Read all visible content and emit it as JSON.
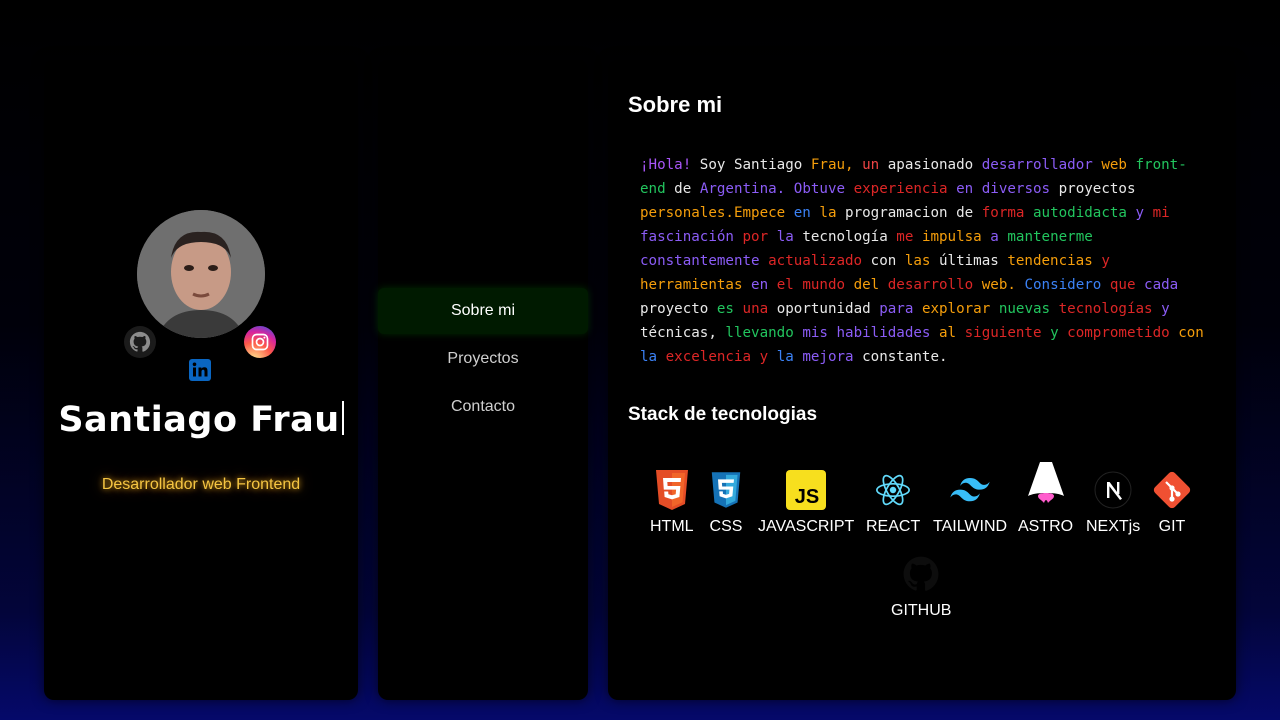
{
  "profile": {
    "name": "Santiago Frau",
    "role": "Desarrollador web Frontend",
    "socials": [
      {
        "icon": "github-icon"
      },
      {
        "icon": "instagram-icon"
      },
      {
        "icon": "linkedin-icon"
      }
    ]
  },
  "nav": {
    "items": [
      {
        "label": "Sobre mi",
        "active": true
      },
      {
        "label": "Proyectos",
        "active": false
      },
      {
        "label": "Contacto",
        "active": false
      }
    ]
  },
  "about": {
    "title": "Sobre mi",
    "words": [
      {
        "t": "¡Hola!",
        "c": "#a855f7"
      },
      {
        "t": "Soy",
        "c": "#e8e8e8"
      },
      {
        "t": "Santiago",
        "c": "#e8e8e8"
      },
      {
        "t": "Frau,",
        "c": "#f59e0b"
      },
      {
        "t": "un",
        "c": "#ef4444"
      },
      {
        "t": "apasionado",
        "c": "#e8e8e8"
      },
      {
        "t": "desarrollador",
        "c": "#8b5cf6"
      },
      {
        "t": "web",
        "c": "#f59e0b"
      },
      {
        "t": "front-end",
        "c": "#22c55e"
      },
      {
        "t": "de",
        "c": "#e8e8e8"
      },
      {
        "t": "Argentina.",
        "c": "#8b5cf6"
      },
      {
        "t": "Obtuve",
        "c": "#8b5cf6"
      },
      {
        "t": "experiencia",
        "c": "#dc2626"
      },
      {
        "t": "en",
        "c": "#8b5cf6"
      },
      {
        "t": "diversos",
        "c": "#8b5cf6"
      },
      {
        "t": "proyectos",
        "c": "#e8e8e8"
      },
      {
        "t": "personales.Empece",
        "c": "#f59e0b"
      },
      {
        "t": "en",
        "c": "#3b82f6"
      },
      {
        "t": "la",
        "c": "#f59e0b"
      },
      {
        "t": "programacion",
        "c": "#e8e8e8"
      },
      {
        "t": "de",
        "c": "#e8e8e8"
      },
      {
        "t": "forma",
        "c": "#dc2626"
      },
      {
        "t": "autodidacta",
        "c": "#22c55e"
      },
      {
        "t": "y",
        "c": "#8b5cf6"
      },
      {
        "t": "mi",
        "c": "#dc2626"
      },
      {
        "t": "fascinación",
        "c": "#8b5cf6"
      },
      {
        "t": "por",
        "c": "#dc2626"
      },
      {
        "t": "la",
        "c": "#8b5cf6"
      },
      {
        "t": "tecnología",
        "c": "#e8e8e8"
      },
      {
        "t": "me",
        "c": "#dc2626"
      },
      {
        "t": "impulsa",
        "c": "#f59e0b"
      },
      {
        "t": "a",
        "c": "#8b5cf6"
      },
      {
        "t": "mantenerme",
        "c": "#22c55e"
      },
      {
        "t": "constantemente",
        "c": "#8b5cf6"
      },
      {
        "t": "actualizado",
        "c": "#dc2626"
      },
      {
        "t": "con",
        "c": "#e8e8e8"
      },
      {
        "t": "las",
        "c": "#f59e0b"
      },
      {
        "t": "últimas",
        "c": "#e8e8e8"
      },
      {
        "t": "tendencias",
        "c": "#f59e0b"
      },
      {
        "t": "y",
        "c": "#dc2626"
      },
      {
        "t": "herramientas",
        "c": "#f59e0b"
      },
      {
        "t": "en",
        "c": "#8b5cf6"
      },
      {
        "t": "el",
        "c": "#dc2626"
      },
      {
        "t": "mundo",
        "c": "#dc2626"
      },
      {
        "t": "del",
        "c": "#f59e0b"
      },
      {
        "t": "desarrollo",
        "c": "#dc2626"
      },
      {
        "t": "web.",
        "c": "#f59e0b"
      },
      {
        "t": "Considero",
        "c": "#3b82f6"
      },
      {
        "t": "que",
        "c": "#dc2626"
      },
      {
        "t": "cada",
        "c": "#8b5cf6"
      },
      {
        "t": "proyecto",
        "c": "#e8e8e8"
      },
      {
        "t": "es",
        "c": "#22c55e"
      },
      {
        "t": "una",
        "c": "#dc2626"
      },
      {
        "t": "oportunidad",
        "c": "#e8e8e8"
      },
      {
        "t": "para",
        "c": "#8b5cf6"
      },
      {
        "t": "explorar",
        "c": "#f59e0b"
      },
      {
        "t": "nuevas",
        "c": "#22c55e"
      },
      {
        "t": "tecnologías",
        "c": "#dc2626"
      },
      {
        "t": "y",
        "c": "#8b5cf6"
      },
      {
        "t": "técnicas,",
        "c": "#e8e8e8"
      },
      {
        "t": "llevando",
        "c": "#22c55e"
      },
      {
        "t": "mis",
        "c": "#8b5cf6"
      },
      {
        "t": "habilidades",
        "c": "#8b5cf6"
      },
      {
        "t": "al",
        "c": "#f59e0b"
      },
      {
        "t": "siguiente",
        "c": "#dc2626"
      },
      {
        "t": "y",
        "c": "#22c55e"
      },
      {
        "t": "comprometido",
        "c": "#dc2626"
      },
      {
        "t": "con",
        "c": "#f59e0b"
      },
      {
        "t": "la",
        "c": "#3b82f6"
      },
      {
        "t": "excelencia",
        "c": "#dc2626"
      },
      {
        "t": "y",
        "c": "#dc2626"
      },
      {
        "t": "la",
        "c": "#3b82f6"
      },
      {
        "t": "mejora",
        "c": "#8b5cf6"
      },
      {
        "t": "constante.",
        "c": "#e8e8e8"
      }
    ]
  },
  "stack": {
    "title": "Stack de tecnologias",
    "items": [
      {
        "label": "HTML",
        "icon": "html5-icon"
      },
      {
        "label": "CSS",
        "icon": "css3-icon"
      },
      {
        "label": "JAVASCRIPT",
        "icon": "javascript-icon"
      },
      {
        "label": "REACT",
        "icon": "react-icon"
      },
      {
        "label": "TAILWIND",
        "icon": "tailwind-icon"
      },
      {
        "label": "ASTRO",
        "icon": "astro-icon"
      },
      {
        "label": "NEXTjs",
        "icon": "nextjs-icon"
      },
      {
        "label": "GIT",
        "icon": "git-icon"
      },
      {
        "label": "GITHUB",
        "icon": "github-icon"
      }
    ]
  },
  "colors": {
    "accent": "#f5c542",
    "nav_active": "#001a00"
  }
}
